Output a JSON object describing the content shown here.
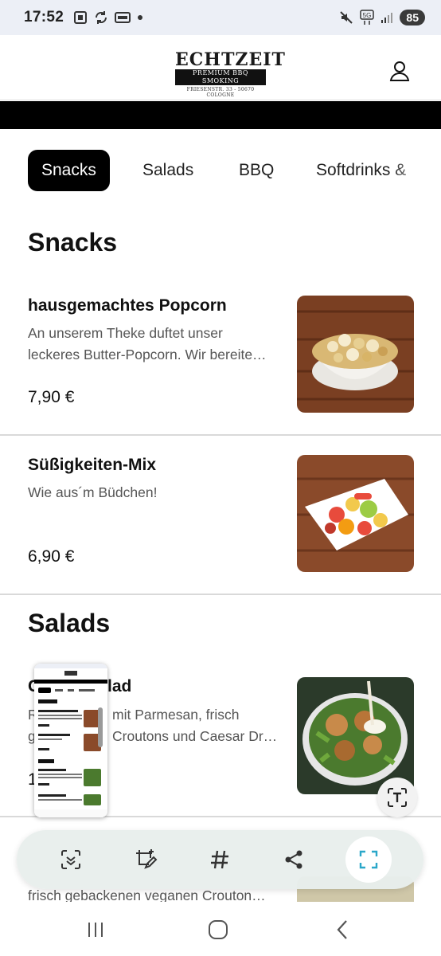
{
  "status_bar": {
    "time": "17:52",
    "battery": "85",
    "icons": [
      "screenshot-icon",
      "sync-icon",
      "card-icon",
      "dot-icon",
      "mute-icon",
      "5g-icon",
      "signal-icon"
    ]
  },
  "header": {
    "logo": {
      "title": "ECHTZEIT",
      "subtitle": "PREMIUM BBQ SMOKING",
      "address": "FRIESENSTR. 33 - 50670 COLOGNE"
    }
  },
  "tabs": [
    "Snacks",
    "Salads",
    "BBQ",
    "Softdrinks &"
  ],
  "active_tab": "Snacks",
  "sections": {
    "snacks": {
      "title": "Snacks",
      "items": [
        {
          "name": "hausgemachtes Popcorn",
          "desc_line1": "An unserem Theke duftet unser",
          "desc_line2": "leckeres Butter-Popcorn. Wir bereite…",
          "price": "7,90 €"
        },
        {
          "name": "Süßigkeiten-Mix",
          "desc_line1": "Wie aus´m Büdchen!",
          "price": "6,90 €"
        }
      ]
    },
    "salads": {
      "title": "Salads",
      "items": [
        {
          "name_visible": "C",
          "name_visible_end": "lad",
          "desc_line1_start": "R",
          "desc_line1_end": "mit Parmesan, frisch",
          "desc_line2_start": "g",
          "desc_line2_end": "Croutons und Caesar Dr…",
          "price_start": "1"
        }
      ],
      "next_item_desc": "frisch gebackenen veganen Crouton…"
    }
  },
  "colors": {
    "accent": "#000000",
    "capture_icon": "#2aa7c9",
    "status_bg": "#eceff6"
  }
}
